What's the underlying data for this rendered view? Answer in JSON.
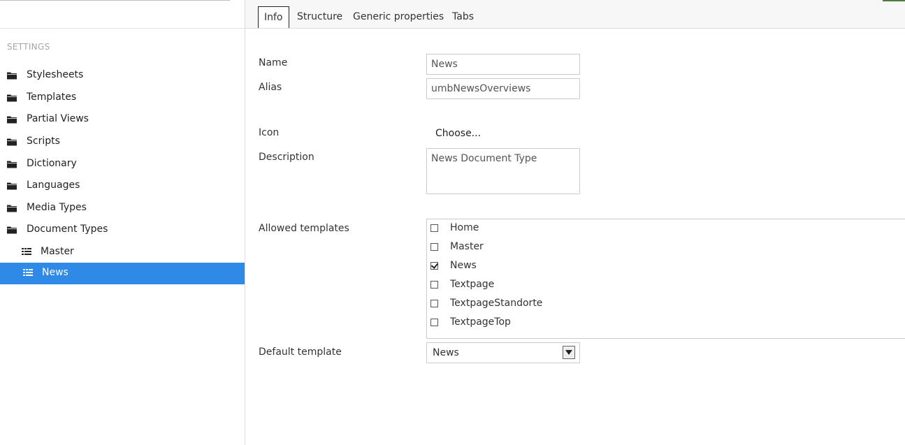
{
  "sidebar": {
    "section_heading": "SETTINGS",
    "items": [
      {
        "label": "Stylesheets",
        "icon": "folder-icon"
      },
      {
        "label": "Templates",
        "icon": "folder-icon"
      },
      {
        "label": "Partial Views",
        "icon": "folder-icon"
      },
      {
        "label": "Scripts",
        "icon": "folder-icon"
      },
      {
        "label": "Dictionary",
        "icon": "folder-icon"
      },
      {
        "label": "Languages",
        "icon": "folder-icon"
      },
      {
        "label": "Media Types",
        "icon": "folder-icon"
      },
      {
        "label": "Document Types",
        "icon": "folder-icon"
      }
    ],
    "children": [
      {
        "label": "Master",
        "icon": "document-type-icon",
        "selected": false
      },
      {
        "label": "News",
        "icon": "document-type-icon",
        "selected": true
      }
    ],
    "selected_color": "#2e8ae6"
  },
  "tabs": [
    {
      "label": "Info",
      "active": true
    },
    {
      "label": "Structure",
      "active": false
    },
    {
      "label": "Generic properties",
      "active": false
    },
    {
      "label": "Tabs",
      "active": false
    }
  ],
  "form": {
    "name_label": "Name",
    "name_value": "News",
    "alias_label": "Alias",
    "alias_value": "umbNewsOverviews",
    "icon_label": "Icon",
    "icon_choose": "Choose...",
    "description_label": "Description",
    "description_value": "News Document Type",
    "allowed_templates_label": "Allowed templates",
    "allowed_templates": [
      {
        "label": "Home",
        "checked": false
      },
      {
        "label": "Master",
        "checked": false
      },
      {
        "label": "News",
        "checked": true
      },
      {
        "label": "Textpage",
        "checked": false
      },
      {
        "label": "TextpageStandorte",
        "checked": false
      },
      {
        "label": "TextpageTop",
        "checked": false
      }
    ],
    "default_template_label": "Default template",
    "default_template_value": "News"
  }
}
